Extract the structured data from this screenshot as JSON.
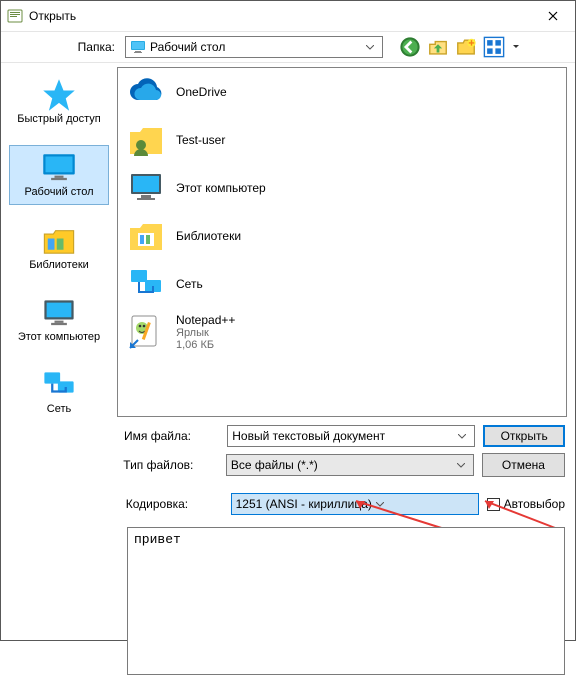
{
  "title": "Открыть",
  "toolbar": {
    "folder_label": "Папка:",
    "folder_value": "Рабочий стол"
  },
  "places": [
    {
      "label": "Быстрый доступ"
    },
    {
      "label": "Рабочий стол"
    },
    {
      "label": "Библиотеки"
    },
    {
      "label": "Этот компьютер"
    },
    {
      "label": "Сеть"
    }
  ],
  "files": [
    {
      "name": "OneDrive"
    },
    {
      "name": "Test-user"
    },
    {
      "name": "Этот компьютер"
    },
    {
      "name": "Библиотеки"
    },
    {
      "name": "Сеть"
    },
    {
      "name": "Notepad++",
      "sub1": "Ярлык",
      "sub2": "1,06 КБ"
    }
  ],
  "form": {
    "filename_label": "Имя файла:",
    "filename_value": "Новый текстовый документ",
    "filetype_label": "Тип файлов:",
    "filetype_value": "Все файлы (*.*)",
    "encoding_label": "Кодировка:",
    "encoding_value": "1251  (ANSI - кириллица)",
    "open_btn": "Открыть",
    "cancel_btn": "Отмена",
    "auto_label": "Автовыбор"
  },
  "preview_text": "привет"
}
